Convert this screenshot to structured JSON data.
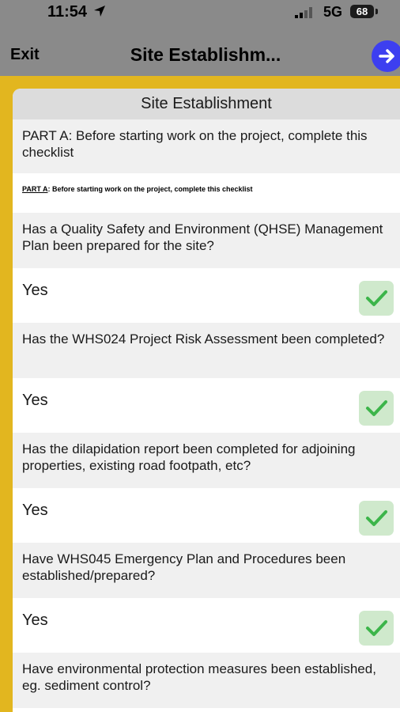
{
  "status_bar": {
    "time": "11:54",
    "network": "5G",
    "battery": "68"
  },
  "nav": {
    "exit_label": "Exit",
    "title": "Site Establishm..."
  },
  "section": {
    "header": "Site Establishment"
  },
  "part_a": {
    "prompt": "PART A: Before starting work on the project, complete this checklist",
    "small_lead": "PART A",
    "small_rest": ": Before starting work on the project, complete this checklist"
  },
  "questions": [
    {
      "text": "Has a Quality Safety and Environment (QHSE) Management Plan been prepared for the site?",
      "answer": "Yes"
    },
    {
      "text": "Has the WHS024 Project Risk Assessment been completed?",
      "answer": "Yes"
    },
    {
      "text": "Has the dilapidation report been completed for adjoining properties, existing road footpath, etc?",
      "answer": "Yes"
    },
    {
      "text": "Have WHS045 Emergency Plan and Procedures been established/prepared?",
      "answer": "Yes"
    },
    {
      "text": "Have environmental protection measures been established, eg. sediment control?",
      "answer": ""
    }
  ],
  "colors": {
    "accent": "#e2b61f",
    "nav_bg": "#8a8a8a",
    "next_button": "#3d3ff0",
    "check_green": "#3cb54a",
    "check_bg": "#cfe9cc"
  }
}
